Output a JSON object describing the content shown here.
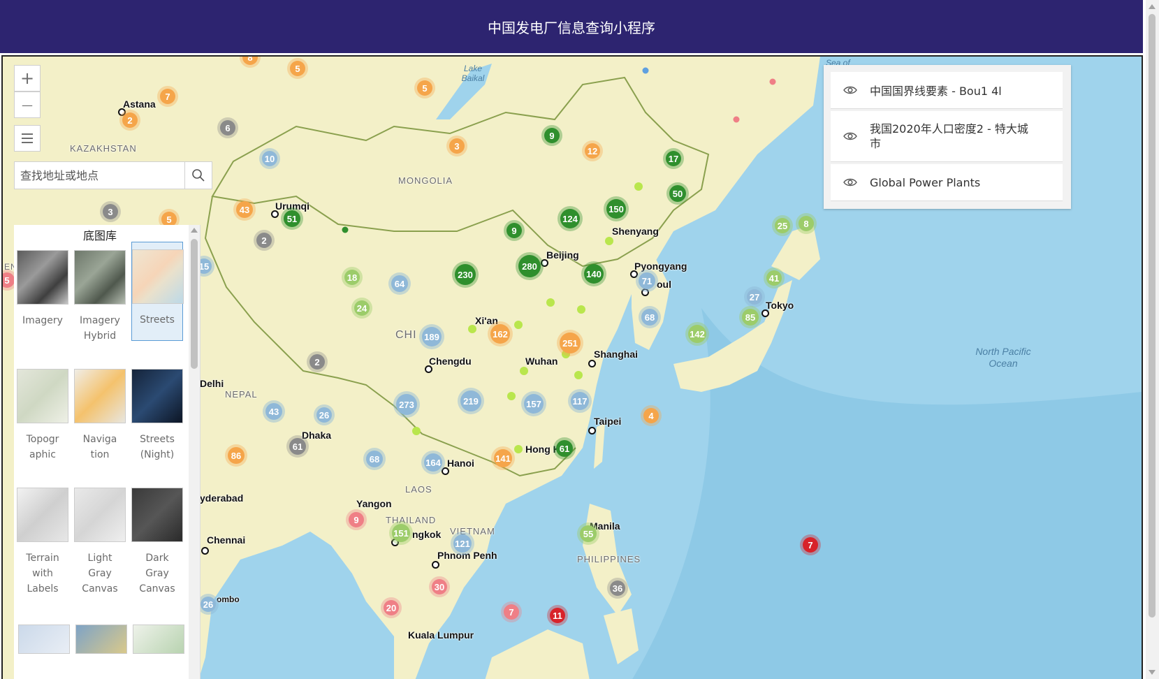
{
  "header": {
    "title": "中国发电厂信息查询小程序"
  },
  "controls": {
    "zoom_in": "+",
    "zoom_out": "—"
  },
  "search": {
    "placeholder": "查找地址或地点"
  },
  "gallery": {
    "title": "底图库",
    "items": [
      {
        "label": "Imagery",
        "selected": false
      },
      {
        "label": "Imagery Hybrid",
        "selected": false
      },
      {
        "label": "Streets",
        "selected": true
      },
      {
        "label": "Topographic",
        "selected": false
      },
      {
        "label": "Navigation",
        "selected": false
      },
      {
        "label": "Streets (Night)",
        "selected": false
      },
      {
        "label": "Terrain with Labels",
        "selected": false
      },
      {
        "label": "Light Gray Canvas",
        "selected": false
      },
      {
        "label": "Dark Gray Canvas",
        "selected": false
      }
    ]
  },
  "layers": [
    {
      "title": "中国国界线要素 - Bou1 4l"
    },
    {
      "title": "我国2020年人口密度2 - 特大城市"
    },
    {
      "title": "Global Power Plants"
    }
  ],
  "map_labels": {
    "astana": "Astana",
    "kazakhstan": "KAZAKHSTAN",
    "lake_baikal": "Lake Baikal",
    "mongolia": "MONGOLIA",
    "urumqi": "Urumqi",
    "shenyang": "Shenyang",
    "beijing": "Beijing",
    "pyongyang": "Pyongyang",
    "seoul": "oul",
    "tokyo": "Tokyo",
    "xian": "Xi'an",
    "chengdu": "Chengdu",
    "wuhan": "Wuhan",
    "shanghai": "Shanghai",
    "china": "CHI",
    "delhi": "Delhi",
    "nepal": "NEPAL",
    "dhaka": "Dhaka",
    "hanoi": "Hanoi",
    "taipei": "Taipei",
    "hongkong": "Hong K",
    "laos": "LAOS",
    "yangon": "Yangon",
    "thailand": "THAILAND",
    "vietnam": "VIETNAM",
    "bangkok": "ngkok",
    "hyderabad": "yderabad",
    "chennai": "Chennai",
    "phnompenh": "Phnom Penh",
    "manila": "Manila",
    "philippines": "PHILIPPINES",
    "colombo": "ombo",
    "kualalumpur": "Kuala Lumpur",
    "northpacific": "North Pacific Ocean",
    "seaof": "Sea of",
    "en": "EN"
  },
  "colors": {
    "header_bg": "#2d2470",
    "land": "#f3f0c8",
    "water": "#9fd3ec"
  },
  "clusters": [
    {
      "id": "c1",
      "value": "8",
      "color": "orange"
    },
    {
      "id": "c2",
      "value": "5",
      "color": "orange"
    },
    {
      "id": "c3",
      "value": "7",
      "color": "orange"
    },
    {
      "id": "c4",
      "value": "2",
      "color": "orange"
    },
    {
      "id": "c5",
      "value": "5",
      "color": "orange"
    },
    {
      "id": "c6",
      "value": "6",
      "color": "gray"
    },
    {
      "id": "c7",
      "value": "10",
      "color": "blue"
    },
    {
      "id": "c8",
      "value": "3",
      "color": "orange"
    },
    {
      "id": "c9",
      "value": "9",
      "color": "green"
    },
    {
      "id": "c10",
      "value": "12",
      "color": "orange"
    },
    {
      "id": "c11",
      "value": "17",
      "color": "green"
    },
    {
      "id": "c12",
      "value": "50",
      "color": "green"
    },
    {
      "id": "c13",
      "value": "3",
      "color": "gray"
    },
    {
      "id": "c14",
      "value": "5",
      "color": "orange"
    },
    {
      "id": "c15",
      "value": "43",
      "color": "orange"
    },
    {
      "id": "c16",
      "value": "51",
      "color": "green"
    },
    {
      "id": "c17",
      "value": "2",
      "color": "gray"
    },
    {
      "id": "c18",
      "value": "124",
      "color": "green"
    },
    {
      "id": "c19",
      "value": "150",
      "color": "green"
    },
    {
      "id": "c20",
      "value": "9",
      "color": "green"
    },
    {
      "id": "c21",
      "value": "25",
      "color": "lightgreen"
    },
    {
      "id": "c22",
      "value": "8",
      "color": "lightgreen"
    },
    {
      "id": "c23",
      "value": "15",
      "color": "blue"
    },
    {
      "id": "c24",
      "value": "18",
      "color": "lightgreen"
    },
    {
      "id": "c25",
      "value": "64",
      "color": "blue"
    },
    {
      "id": "c26",
      "value": "230",
      "color": "green"
    },
    {
      "id": "c27",
      "value": "280",
      "color": "green"
    },
    {
      "id": "c28",
      "value": "140",
      "color": "green"
    },
    {
      "id": "c29",
      "value": "71",
      "color": "blue"
    },
    {
      "id": "c30",
      "value": "41",
      "color": "lightgreen"
    },
    {
      "id": "c31",
      "value": "5",
      "color": "pink"
    },
    {
      "id": "c32",
      "value": "24",
      "color": "lightgreen"
    },
    {
      "id": "c33",
      "value": "27",
      "color": "blue"
    },
    {
      "id": "c34",
      "value": "68",
      "color": "blue"
    },
    {
      "id": "c35",
      "value": "85",
      "color": "lightgreen"
    },
    {
      "id": "c36",
      "value": "189",
      "color": "blue"
    },
    {
      "id": "c37",
      "value": "162",
      "color": "orange"
    },
    {
      "id": "c38",
      "value": "251",
      "color": "orange"
    },
    {
      "id": "c39",
      "value": "142",
      "color": "lightgreen"
    },
    {
      "id": "c40",
      "value": "2",
      "color": "gray"
    },
    {
      "id": "c41",
      "value": "273",
      "color": "blue"
    },
    {
      "id": "c42",
      "value": "219",
      "color": "blue"
    },
    {
      "id": "c43",
      "value": "157",
      "color": "blue"
    },
    {
      "id": "c44",
      "value": "117",
      "color": "blue"
    },
    {
      "id": "c45",
      "value": "43",
      "color": "blue"
    },
    {
      "id": "c46",
      "value": "26",
      "color": "blue"
    },
    {
      "id": "c47",
      "value": "4",
      "color": "orange"
    },
    {
      "id": "c48",
      "value": "61",
      "color": "gray"
    },
    {
      "id": "c49",
      "value": "86",
      "color": "orange"
    },
    {
      "id": "c50",
      "value": "68",
      "color": "blue"
    },
    {
      "id": "c51",
      "value": "164",
      "color": "blue"
    },
    {
      "id": "c52",
      "value": "141",
      "color": "orange"
    },
    {
      "id": "c53",
      "value": "61",
      "color": "green"
    },
    {
      "id": "c54",
      "value": "9",
      "color": "pink"
    },
    {
      "id": "c55",
      "value": "151",
      "color": "lightgreen"
    },
    {
      "id": "c56",
      "value": "121",
      "color": "blue"
    },
    {
      "id": "c57",
      "value": "55",
      "color": "lightgreen"
    },
    {
      "id": "c58",
      "value": "7",
      "color": "red"
    },
    {
      "id": "c59",
      "value": "30",
      "color": "pink"
    },
    {
      "id": "c60",
      "value": "36",
      "color": "gray"
    },
    {
      "id": "c61",
      "value": "26",
      "color": "blue"
    },
    {
      "id": "c62",
      "value": "20",
      "color": "pink"
    },
    {
      "id": "c63",
      "value": "7",
      "color": "pink"
    },
    {
      "id": "c64",
      "value": "11",
      "color": "red"
    }
  ]
}
